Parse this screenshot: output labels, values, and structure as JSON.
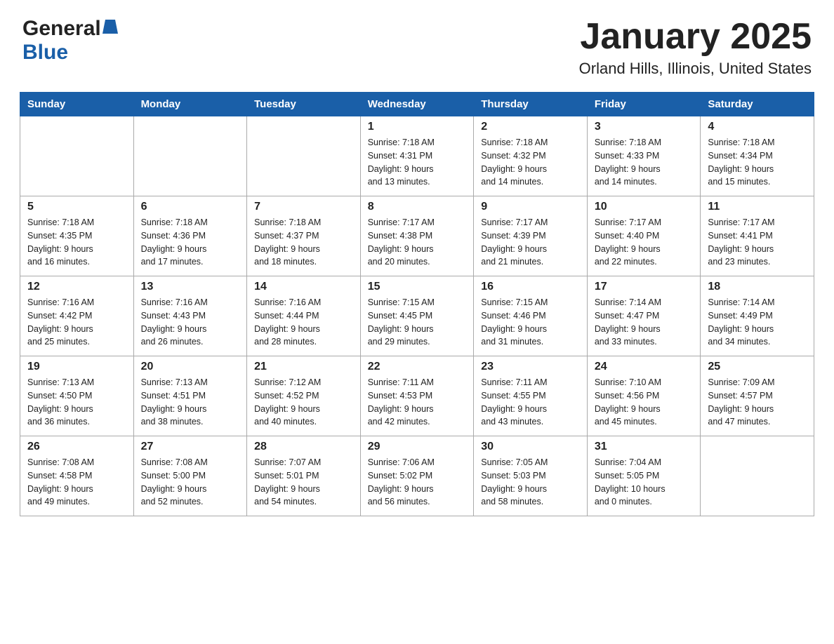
{
  "header": {
    "title": "January 2025",
    "subtitle": "Orland Hills, Illinois, United States",
    "logo_general": "General",
    "logo_blue": "Blue"
  },
  "days_of_week": [
    "Sunday",
    "Monday",
    "Tuesday",
    "Wednesday",
    "Thursday",
    "Friday",
    "Saturday"
  ],
  "weeks": [
    [
      {
        "day": "",
        "info": ""
      },
      {
        "day": "",
        "info": ""
      },
      {
        "day": "",
        "info": ""
      },
      {
        "day": "1",
        "info": "Sunrise: 7:18 AM\nSunset: 4:31 PM\nDaylight: 9 hours\nand 13 minutes."
      },
      {
        "day": "2",
        "info": "Sunrise: 7:18 AM\nSunset: 4:32 PM\nDaylight: 9 hours\nand 14 minutes."
      },
      {
        "day": "3",
        "info": "Sunrise: 7:18 AM\nSunset: 4:33 PM\nDaylight: 9 hours\nand 14 minutes."
      },
      {
        "day": "4",
        "info": "Sunrise: 7:18 AM\nSunset: 4:34 PM\nDaylight: 9 hours\nand 15 minutes."
      }
    ],
    [
      {
        "day": "5",
        "info": "Sunrise: 7:18 AM\nSunset: 4:35 PM\nDaylight: 9 hours\nand 16 minutes."
      },
      {
        "day": "6",
        "info": "Sunrise: 7:18 AM\nSunset: 4:36 PM\nDaylight: 9 hours\nand 17 minutes."
      },
      {
        "day": "7",
        "info": "Sunrise: 7:18 AM\nSunset: 4:37 PM\nDaylight: 9 hours\nand 18 minutes."
      },
      {
        "day": "8",
        "info": "Sunrise: 7:17 AM\nSunset: 4:38 PM\nDaylight: 9 hours\nand 20 minutes."
      },
      {
        "day": "9",
        "info": "Sunrise: 7:17 AM\nSunset: 4:39 PM\nDaylight: 9 hours\nand 21 minutes."
      },
      {
        "day": "10",
        "info": "Sunrise: 7:17 AM\nSunset: 4:40 PM\nDaylight: 9 hours\nand 22 minutes."
      },
      {
        "day": "11",
        "info": "Sunrise: 7:17 AM\nSunset: 4:41 PM\nDaylight: 9 hours\nand 23 minutes."
      }
    ],
    [
      {
        "day": "12",
        "info": "Sunrise: 7:16 AM\nSunset: 4:42 PM\nDaylight: 9 hours\nand 25 minutes."
      },
      {
        "day": "13",
        "info": "Sunrise: 7:16 AM\nSunset: 4:43 PM\nDaylight: 9 hours\nand 26 minutes."
      },
      {
        "day": "14",
        "info": "Sunrise: 7:16 AM\nSunset: 4:44 PM\nDaylight: 9 hours\nand 28 minutes."
      },
      {
        "day": "15",
        "info": "Sunrise: 7:15 AM\nSunset: 4:45 PM\nDaylight: 9 hours\nand 29 minutes."
      },
      {
        "day": "16",
        "info": "Sunrise: 7:15 AM\nSunset: 4:46 PM\nDaylight: 9 hours\nand 31 minutes."
      },
      {
        "day": "17",
        "info": "Sunrise: 7:14 AM\nSunset: 4:47 PM\nDaylight: 9 hours\nand 33 minutes."
      },
      {
        "day": "18",
        "info": "Sunrise: 7:14 AM\nSunset: 4:49 PM\nDaylight: 9 hours\nand 34 minutes."
      }
    ],
    [
      {
        "day": "19",
        "info": "Sunrise: 7:13 AM\nSunset: 4:50 PM\nDaylight: 9 hours\nand 36 minutes."
      },
      {
        "day": "20",
        "info": "Sunrise: 7:13 AM\nSunset: 4:51 PM\nDaylight: 9 hours\nand 38 minutes."
      },
      {
        "day": "21",
        "info": "Sunrise: 7:12 AM\nSunset: 4:52 PM\nDaylight: 9 hours\nand 40 minutes."
      },
      {
        "day": "22",
        "info": "Sunrise: 7:11 AM\nSunset: 4:53 PM\nDaylight: 9 hours\nand 42 minutes."
      },
      {
        "day": "23",
        "info": "Sunrise: 7:11 AM\nSunset: 4:55 PM\nDaylight: 9 hours\nand 43 minutes."
      },
      {
        "day": "24",
        "info": "Sunrise: 7:10 AM\nSunset: 4:56 PM\nDaylight: 9 hours\nand 45 minutes."
      },
      {
        "day": "25",
        "info": "Sunrise: 7:09 AM\nSunset: 4:57 PM\nDaylight: 9 hours\nand 47 minutes."
      }
    ],
    [
      {
        "day": "26",
        "info": "Sunrise: 7:08 AM\nSunset: 4:58 PM\nDaylight: 9 hours\nand 49 minutes."
      },
      {
        "day": "27",
        "info": "Sunrise: 7:08 AM\nSunset: 5:00 PM\nDaylight: 9 hours\nand 52 minutes."
      },
      {
        "day": "28",
        "info": "Sunrise: 7:07 AM\nSunset: 5:01 PM\nDaylight: 9 hours\nand 54 minutes."
      },
      {
        "day": "29",
        "info": "Sunrise: 7:06 AM\nSunset: 5:02 PM\nDaylight: 9 hours\nand 56 minutes."
      },
      {
        "day": "30",
        "info": "Sunrise: 7:05 AM\nSunset: 5:03 PM\nDaylight: 9 hours\nand 58 minutes."
      },
      {
        "day": "31",
        "info": "Sunrise: 7:04 AM\nSunset: 5:05 PM\nDaylight: 10 hours\nand 0 minutes."
      },
      {
        "day": "",
        "info": ""
      }
    ]
  ]
}
